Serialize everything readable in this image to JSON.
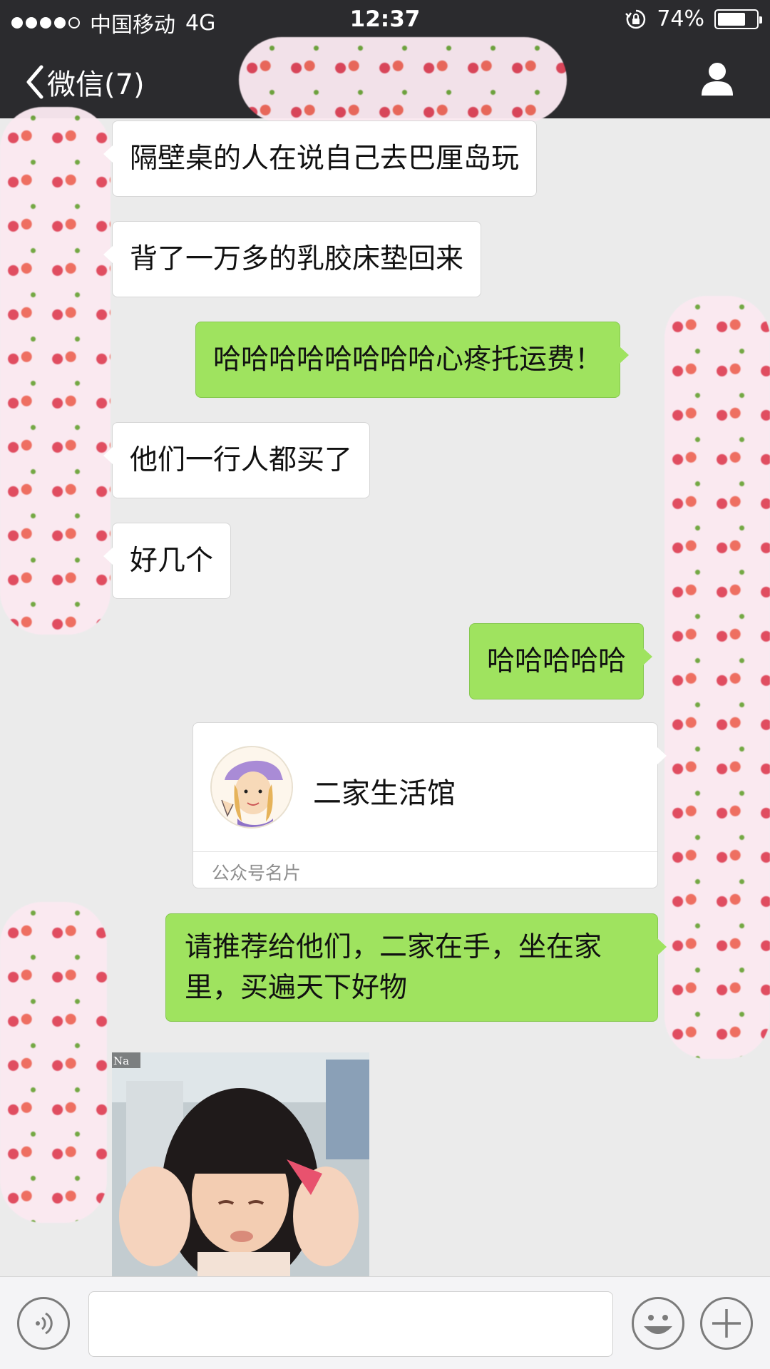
{
  "status_bar": {
    "carrier": "中国移动",
    "network": "4G",
    "time": "12:37",
    "battery": "74%",
    "battery_level": 0.74
  },
  "nav": {
    "back_label": "微信(7)"
  },
  "messages": [
    {
      "side": "in",
      "text": "隔壁桌的人在说自己去巴厘岛玩"
    },
    {
      "side": "in",
      "text": "背了一万多的乳胶床垫回来"
    },
    {
      "side": "out",
      "text": "哈哈哈哈哈哈哈哈心疼托运费！"
    },
    {
      "side": "in",
      "text": "他们一行人都买了"
    },
    {
      "side": "in",
      "text": "好几个"
    },
    {
      "side": "out",
      "text": "哈哈哈哈哈"
    },
    {
      "side": "out",
      "text": "请推荐给他们，二家在手，坐在家里，买遍天下好物"
    }
  ],
  "card": {
    "name": "二家生活馆",
    "label": "公众号名片"
  },
  "photo": {
    "watermark": "Na"
  },
  "colors": {
    "nav_bg": "#2b2b2e",
    "chat_bg": "#ebebeb",
    "out_bubble": "#9fe35f",
    "in_bubble": "#ffffff"
  }
}
